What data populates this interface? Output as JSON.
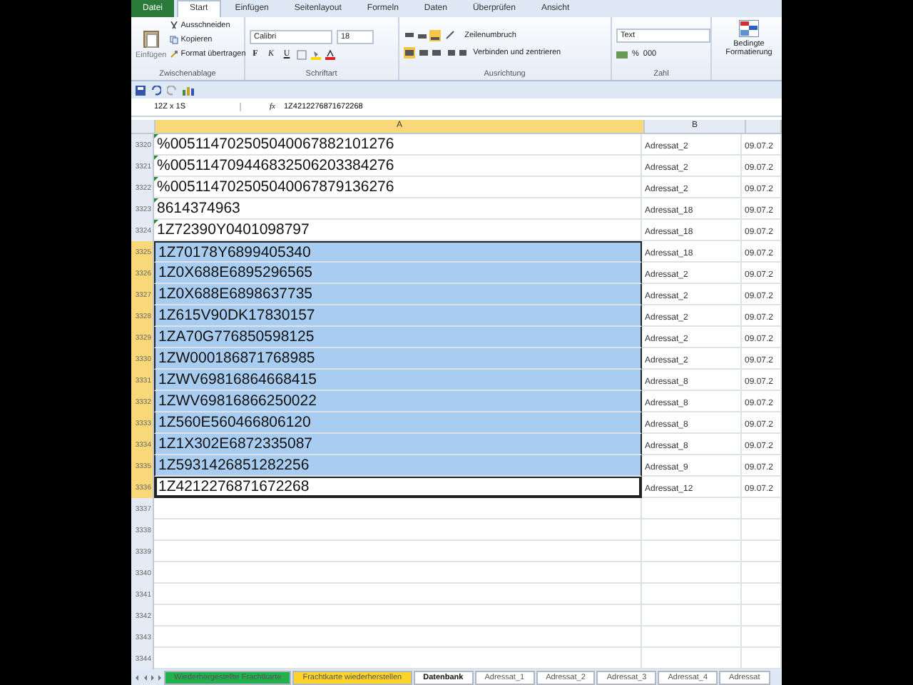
{
  "ribbon_tabs": [
    {
      "label": "Datei",
      "kind": "file",
      "selected": false
    },
    {
      "label": "Start",
      "kind": "tab",
      "selected": true
    },
    {
      "label": "Einfügen",
      "kind": "tab",
      "selected": false
    },
    {
      "label": "Seitenlayout",
      "kind": "tab",
      "selected": false
    },
    {
      "label": "Formeln",
      "kind": "tab",
      "selected": false
    },
    {
      "label": "Daten",
      "kind": "tab",
      "selected": false
    },
    {
      "label": "Überprüfen",
      "kind": "tab",
      "selected": false
    },
    {
      "label": "Ansicht",
      "kind": "tab",
      "selected": false
    }
  ],
  "clipboard": {
    "paste": "Einfügen",
    "cut": "Ausschneiden",
    "copy": "Kopieren",
    "format_painter": "Format übertragen",
    "group": "Zwischenablage"
  },
  "font": {
    "family": "Calibri",
    "size": "18",
    "bold": "F",
    "italic": "K",
    "underline": "U",
    "group": "Schriftart"
  },
  "alignment": {
    "wrap": "Zeilenumbruch",
    "merge": "Verbinden und zentrieren",
    "group": "Ausrichtung"
  },
  "number": {
    "format": "Text",
    "percent": "%",
    "thousands": "000",
    "group": "Zahl"
  },
  "styles": {
    "conditional": "Bedingte Formatierung"
  },
  "formula_bar": {
    "name_box": "12Z x 1S",
    "fx": "fx",
    "value": "1Z4212276871672268"
  },
  "columns": [
    {
      "label": "A",
      "selected": true
    },
    {
      "label": "B",
      "selected": false
    },
    {
      "selected": false
    }
  ],
  "rows": [
    {
      "num": "3320",
      "a": "%005114702505040067882101276",
      "b": "Adressat_2",
      "c": "09.07.2",
      "selected": false,
      "active": false,
      "marker": true
    },
    {
      "num": "3321",
      "a": "%005114709446832506203384276",
      "b": "Adressat_2",
      "c": "09.07.2",
      "selected": false,
      "active": false,
      "marker": true
    },
    {
      "num": "3322",
      "a": "%005114702505040067879136276",
      "b": "Adressat_2",
      "c": "09.07.2",
      "selected": false,
      "active": false,
      "marker": true
    },
    {
      "num": "3323",
      "a": "8614374963",
      "b": "Adressat_18",
      "c": "09.07.2",
      "selected": false,
      "active": false,
      "marker": true
    },
    {
      "num": "3324",
      "a": "1Z72390Y0401098797",
      "b": "Adressat_18",
      "c": "09.07.2",
      "selected": false,
      "active": false,
      "marker": true
    },
    {
      "num": "3325",
      "a": "1Z70178Y6899405340",
      "b": "Adressat_18",
      "c": "09.07.2",
      "selected": true,
      "active": false,
      "marker": false
    },
    {
      "num": "3326",
      "a": "1Z0X688E6895296565",
      "b": "Adressat_2",
      "c": "09.07.2",
      "selected": true,
      "active": false,
      "marker": false
    },
    {
      "num": "3327",
      "a": "1Z0X688E6898637735",
      "b": "Adressat_2",
      "c": "09.07.2",
      "selected": true,
      "active": false,
      "marker": false
    },
    {
      "num": "3328",
      "a": "1Z615V90DK17830157",
      "b": "Adressat_2",
      "c": "09.07.2",
      "selected": true,
      "active": false,
      "marker": false
    },
    {
      "num": "3329",
      "a": "1ZA70G776850598125",
      "b": "Adressat_2",
      "c": "09.07.2",
      "selected": true,
      "active": false,
      "marker": false
    },
    {
      "num": "3330",
      "a": "1ZW000186871768985",
      "b": "Adressat_2",
      "c": "09.07.2",
      "selected": true,
      "active": false,
      "marker": false
    },
    {
      "num": "3331",
      "a": "1ZWV69816864668415",
      "b": "Adressat_8",
      "c": "09.07.2",
      "selected": true,
      "active": false,
      "marker": false
    },
    {
      "num": "3332",
      "a": "1ZWV69816866250022",
      "b": "Adressat_8",
      "c": "09.07.2",
      "selected": true,
      "active": false,
      "marker": false
    },
    {
      "num": "3333",
      "a": "1Z560E560466806120",
      "b": "Adressat_8",
      "c": "09.07.2",
      "selected": true,
      "active": false,
      "marker": false
    },
    {
      "num": "3334",
      "a": "1Z1X302E6872335087",
      "b": "Adressat_8",
      "c": "09.07.2",
      "selected": true,
      "active": false,
      "marker": false
    },
    {
      "num": "3335",
      "a": "1Z5931426851282256",
      "b": "Adressat_9",
      "c": "09.07.2",
      "selected": true,
      "active": false,
      "marker": false
    },
    {
      "num": "3336",
      "a": "1Z4212276871672268",
      "b": "Adressat_12",
      "c": "09.07.2",
      "selected": false,
      "active": true,
      "marker": false
    },
    {
      "num": "3337"
    },
    {
      "num": "3338"
    },
    {
      "num": "3339"
    },
    {
      "num": "3340"
    },
    {
      "num": "3341"
    },
    {
      "num": "3342"
    },
    {
      "num": "3343"
    },
    {
      "num": "3344"
    }
  ],
  "sheet_tabs": [
    {
      "label": "Wiederhergestellte Frachtkarte",
      "color": "#22b14c",
      "selected": false
    },
    {
      "label": "Frachtkarte wiederherstellen",
      "color": "#ffd42a",
      "selected": false
    },
    {
      "label": "Datenbank",
      "color": "#ffffff",
      "selected": true
    },
    {
      "label": "Adressat_1",
      "color": "#ffffff",
      "selected": false
    },
    {
      "label": "Adressat_2",
      "color": "#ffffff",
      "selected": false
    },
    {
      "label": "Adressat_3",
      "color": "#ffffff",
      "selected": false
    },
    {
      "label": "Adressat_4",
      "color": "#ffffff",
      "selected": false
    },
    {
      "label": "Adressat",
      "color": "#ffffff",
      "selected": false
    }
  ]
}
